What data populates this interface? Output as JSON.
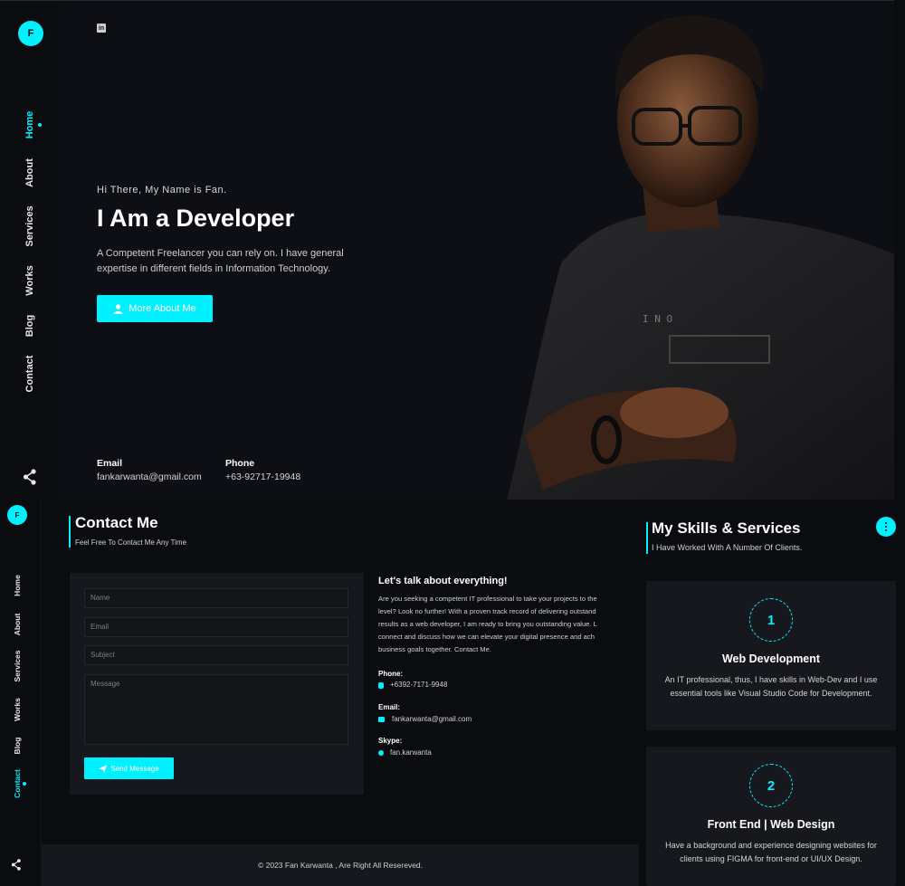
{
  "colors": {
    "accent": "#00f0ff",
    "background": "#0b0c10",
    "panel": "#16181d"
  },
  "hero": {
    "logo_letter": "F",
    "nav": [
      {
        "label": "Home",
        "active": true
      },
      {
        "label": "About",
        "active": false
      },
      {
        "label": "Services",
        "active": false
      },
      {
        "label": "Works",
        "active": false
      },
      {
        "label": "Blog",
        "active": false
      },
      {
        "label": "Contact",
        "active": false
      }
    ],
    "social_icon": "linkedin-icon",
    "greeting": "Hi There, My Name is Fan.",
    "title": "I Am a Developer",
    "description": "A Competent Freelancer you can rely on. I have general expertise in different fields in Information Technology.",
    "button_label": "More About Me",
    "email_label": "Email",
    "email_value": "fankarwanta@gmail.com",
    "phone_label": "Phone",
    "phone_value": "+63-92717-19948"
  },
  "contact_page": {
    "logo_letter": "F",
    "nav": [
      {
        "label": "Home",
        "active": false
      },
      {
        "label": "About",
        "active": false
      },
      {
        "label": "Services",
        "active": false
      },
      {
        "label": "Works",
        "active": false
      },
      {
        "label": "Blog",
        "active": false
      },
      {
        "label": "Contact",
        "active": true
      }
    ],
    "title": "Contact Me",
    "subtitle": "Feel Free To Contact Me Any Time",
    "form": {
      "name_placeholder": "Name",
      "email_placeholder": "Email",
      "subject_placeholder": "Subject",
      "message_placeholder": "Message",
      "send_label": "Send Message"
    },
    "talk_title": "Let's talk about everything!",
    "talk_lines": [
      "Are you seeking a competent IT professional to take your projects to the",
      "level? Look no further! With a proven track record of delivering outstand",
      "results as a web developer, I am ready to bring you outstanding value. L",
      "connect and discuss how we can elevate your digital presence and ach",
      "business goals together. Contact Me."
    ],
    "phone_label": "Phone:",
    "phone_value": "+6392-7171-9948",
    "email_label": "Email:",
    "email_value": "fankarwanta@gmail.com",
    "skype_label": "Skype:",
    "skype_value": "fan.karwanta",
    "footer": "© 2023 Fan Karwanta , Are Right All Resereved."
  },
  "skills_page": {
    "title": "My Skills & Services",
    "subtitle": "I Have Worked With A Number Of Clients.",
    "cards": [
      {
        "number": "1",
        "title": "Web Development",
        "description": "An IT professional, thus, I have skills in Web-Dev and I use essential tools like Visual Studio Code for Development."
      },
      {
        "number": "2",
        "title": "Front End | Web Design",
        "description": "Have a background and experience designing websites for clients using FIGMA for front-end or UI/UX Design."
      }
    ]
  }
}
